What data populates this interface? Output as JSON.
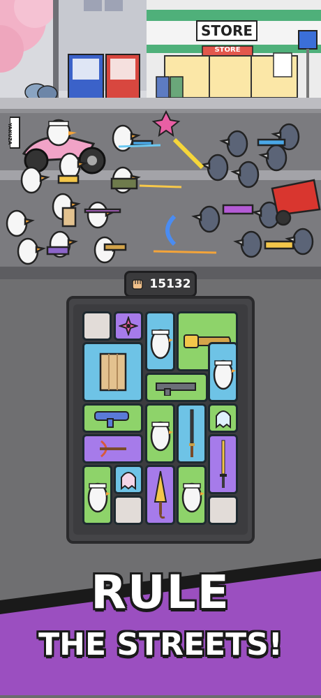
{
  "scene": {
    "store_sign": "STORE",
    "store_awning": "STORE",
    "banner_text": "YAKUZA"
  },
  "hud": {
    "score_icon": "fist-icon",
    "score": "15132"
  },
  "board": {
    "grid_icons": [
      "empty-slot",
      "shuriken-icon",
      "duck-ally-icon",
      "chainsaw-icon",
      "wooden-shield-icon",
      "duck-ally-icon",
      "rocket-launcher-icon",
      "katana-icon",
      "ghost-icon",
      "crossbow-icon",
      "sword-icon",
      "umbrella-icon",
      "empty-slot"
    ]
  },
  "title": {
    "line1": "RULE",
    "line2": "THE STREETS!"
  },
  "colors": {
    "tile_blue": "#6ec3e6",
    "tile_green": "#8ed36a",
    "tile_purple": "#a67bea",
    "banner_purple": "#9b4fc0",
    "road": "#7b7b7f"
  }
}
